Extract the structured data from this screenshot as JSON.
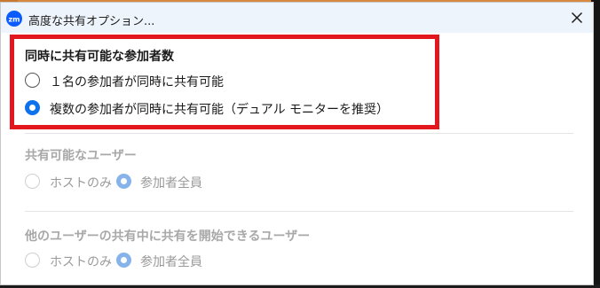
{
  "window": {
    "title": "高度な共有オプション...",
    "app_icon_text": "zm"
  },
  "sections": [
    {
      "title": "同時に共有可能な参加者数",
      "options": [
        {
          "label": "１名の参加者が同時に共有可能",
          "selected": false
        },
        {
          "label": "複数の参加者が同時に共有可能（デュアル モニターを推奨）",
          "selected": true
        }
      ]
    },
    {
      "title": "共有可能なユーザー",
      "options": [
        {
          "label": "ホストのみ",
          "selected": false
        },
        {
          "label": "参加者全員",
          "selected": true
        }
      ]
    },
    {
      "title": "他のユーザーの共有中に共有を開始できるユーザー",
      "options": [
        {
          "label": "ホストのみ",
          "selected": false
        },
        {
          "label": "参加者全員",
          "selected": true
        }
      ]
    }
  ],
  "colors": {
    "accent": "#0e72ed",
    "highlight_border": "#e3171e",
    "titlebar": "#eef4fb"
  }
}
